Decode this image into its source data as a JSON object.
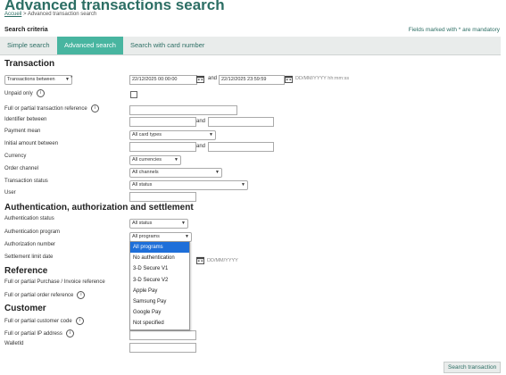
{
  "page": {
    "title": "Advanced transactions search",
    "breadcrumb_home": "Accueil",
    "breadcrumb_current": "> Advanced transaction search",
    "criteria_label": "Search criteria",
    "mandatory_note": "Fields marked with * are mandatory"
  },
  "tabs": [
    {
      "label": "Simple search",
      "active": false
    },
    {
      "label": "Advanced search",
      "active": true
    },
    {
      "label": "Search with card number",
      "active": false
    }
  ],
  "transaction": {
    "heading": "Transaction",
    "date_mode": "Transactions between",
    "date_star": "*",
    "date_from": "22/12/2025 00:00:00",
    "and": "and",
    "date_to": "22/12/2025 23:59:59",
    "date_hint": "DD/MM/YYYY hh:mm:ss",
    "unpaid_label": "Unpaid only",
    "reference_label": "Full or partial transaction reference",
    "identifier_label": "Identifier between",
    "payment_mean_label": "Payment mean",
    "payment_mean_value": "All card types",
    "amount_label": "Initial amount between",
    "currency_label": "Currency",
    "currency_value": "All currencies",
    "order_channel_label": "Order channel",
    "order_channel_value": "All channels",
    "status_label": "Transaction status",
    "status_value": "All status",
    "user_label": "User"
  },
  "auth": {
    "heading": "Authentication, authorization and settlement",
    "auth_status_label": "Authentication status",
    "auth_status_value": "All status",
    "auth_program_label": "Authentication program",
    "auth_program_value": "All programs",
    "authorization_label": "Authorization number",
    "settlement_label": "Settlement limit date",
    "settlement_hint": "DD/MM/YYYY",
    "program_options": [
      "All programs",
      "No authentication",
      "3-D Secure V1",
      "3-D Secure V2",
      "Apple Pay",
      "Samsung Pay",
      "Google Pay",
      "Not specified"
    ]
  },
  "reference": {
    "heading": "Reference",
    "purchase_label": "Full or partial Purchase / Invoice reference",
    "order_label": "Full or partial order reference"
  },
  "customer": {
    "heading": "Customer",
    "code_label": "Full or partial customer code",
    "ip_label": "Full or partial IP address",
    "wallet_label": "WalletId"
  },
  "actions": {
    "search_label": "Search transaction"
  },
  "icons": {
    "info": "info-icon",
    "calendar": "calendar-icon",
    "dropdown": "chevron-down-icon"
  },
  "colors": {
    "brand": "#2c6e64",
    "tab_active": "#48b5a0",
    "option_highlight": "#1e6fd9"
  }
}
